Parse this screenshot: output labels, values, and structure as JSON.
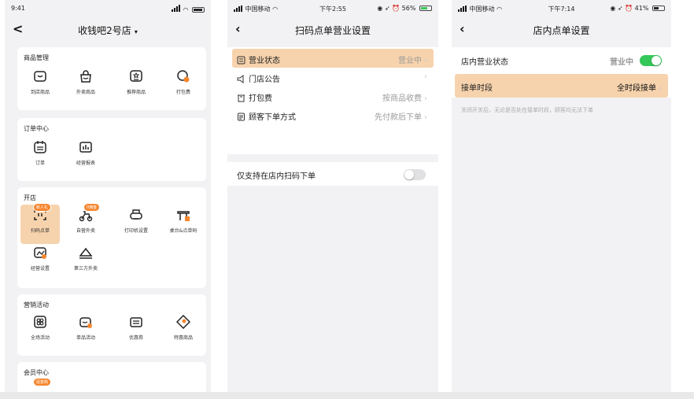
{
  "panel1": {
    "status": {
      "time": "9:41"
    },
    "nav": {
      "title": "收钱吧2号店"
    },
    "sections": {
      "goods": {
        "title": "商品管理",
        "items": [
          "到店商品",
          "外卖商品",
          "推荐商品",
          "打包费"
        ]
      },
      "orders": {
        "title": "订单中心",
        "items": [
          "订单",
          "经营报表"
        ]
      },
      "open_store": {
        "title": "开店",
        "items": [
          "扫码点单",
          "自营外卖",
          "打印机设置",
          "桌台&点单码",
          "经营设置",
          "第三方外卖"
        ],
        "badges": [
          "新人礼",
          "0佣金"
        ]
      },
      "marketing": {
        "title": "营销活动",
        "items": [
          "全场活动",
          "单品活动",
          "优惠券",
          "特惠商品"
        ]
      },
      "members": {
        "title": "会员中心",
        "badges": [
          "促复购"
        ]
      }
    }
  },
  "panel2": {
    "status": {
      "carrier": "中国移动",
      "time": "下午2:55",
      "battery": "56%"
    },
    "nav": {
      "back": "‹",
      "title": "扫码点单营业设置"
    },
    "rows": [
      {
        "label": "营业状态",
        "value": "营业中"
      },
      {
        "label": "门店公告",
        "value": ""
      },
      {
        "label": "打包费",
        "value": "按商品收费"
      },
      {
        "label": "顾客下单方式",
        "value": "先付款后下单"
      }
    ],
    "toggle_row": {
      "label": "仅支持在店内扫码下单",
      "on": false
    }
  },
  "panel3": {
    "status": {
      "carrier": "中国移动",
      "time": "下午7:14",
      "battery": "41%"
    },
    "nav": {
      "back": "‹",
      "title": "店内点单设置"
    },
    "status_row": {
      "label": "店内营业状态",
      "value": "营业中",
      "on": true
    },
    "period_row": {
      "label": "接单时段",
      "value": "全时段接单"
    },
    "note": "关闭开关后，无论是否处在接单时段，顾客均无法下单"
  },
  "colors": {
    "accent": "#f6862e",
    "highlight": "#f7d3ad",
    "toggle_on": "#34c759"
  }
}
